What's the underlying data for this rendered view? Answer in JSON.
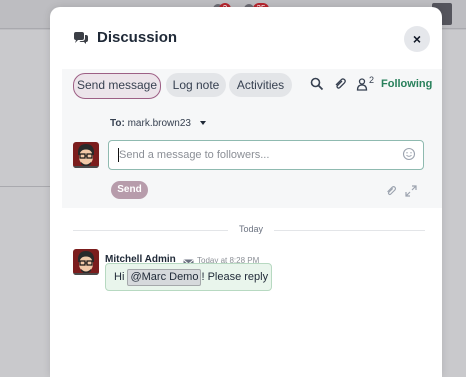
{
  "background": {
    "badge_1": "3",
    "badge_2": "35"
  },
  "dialog": {
    "title": "Discussion",
    "title_icon": "comments-icon",
    "close_icon": "close-icon"
  },
  "composer": {
    "tabs": {
      "send_message": "Send message",
      "log_note": "Log note",
      "activities": "Activities"
    },
    "tools": {
      "search_icon": "search-icon",
      "attachment_icon": "paperclip-icon",
      "followers_icon": "user-icon",
      "followers_count": "2",
      "following_label": "Following"
    },
    "to_label": "To:",
    "recipient": "mark.brown23",
    "input_placeholder": "Send a message to followers...",
    "send_label": "Send"
  },
  "thread": {
    "separator_label": "Today",
    "messages": [
      {
        "author": "Mitchell Admin",
        "time": "Today at 8:28 PM",
        "body_prefix": "Hi",
        "mention": "@Marc Demo",
        "body_suffix": "! Please reply"
      }
    ]
  },
  "colors": {
    "accent": "#9d5f85",
    "following": "#28805b",
    "send_button": "#b79cab",
    "message_bubble": "#e9f5ec"
  }
}
